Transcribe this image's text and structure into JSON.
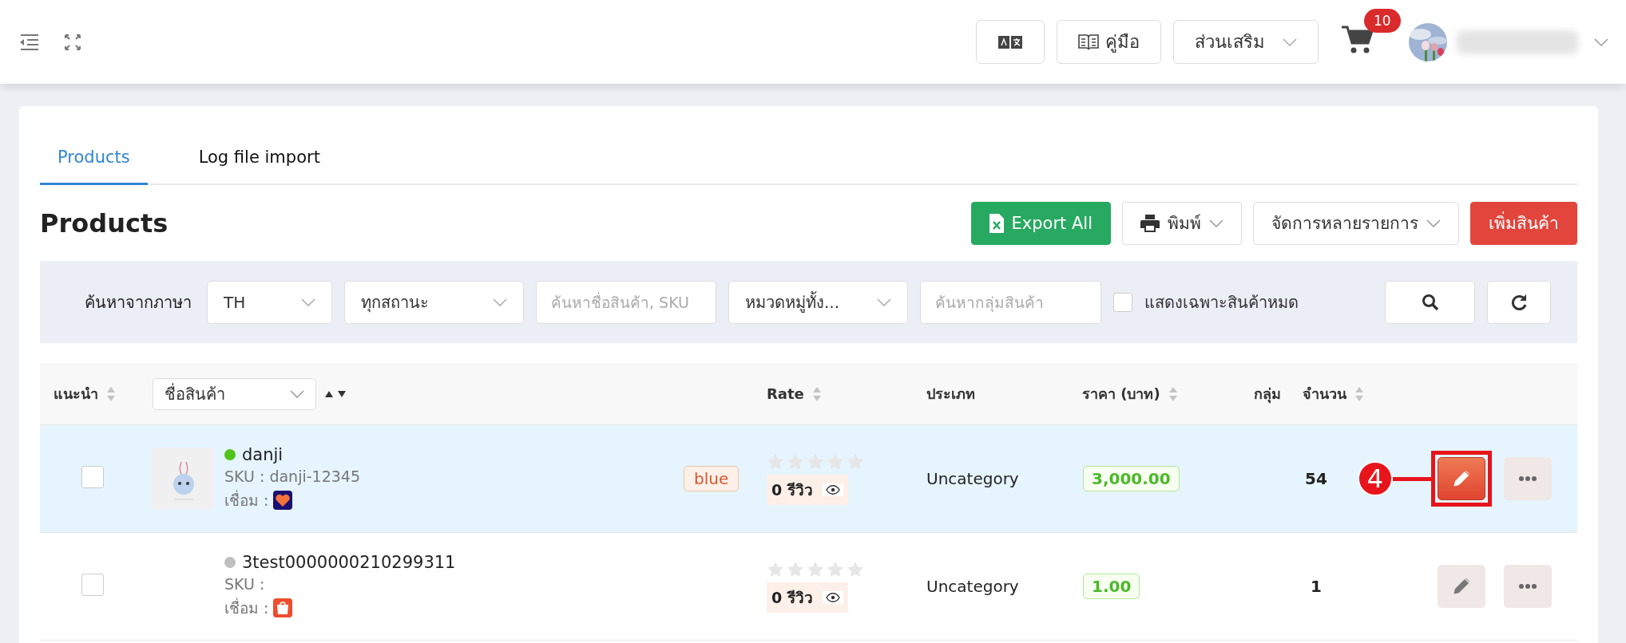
{
  "topbar": {
    "guide_button": "คู่มือ",
    "addons_dropdown": "ส่วนเสริม",
    "cart_count": "10"
  },
  "tabs": [
    {
      "label": "Products",
      "selected": true
    },
    {
      "label": "Log file import",
      "selected": false
    }
  ],
  "page_title": "Products",
  "actions": [
    {
      "label": "Export All",
      "kind": "export"
    },
    {
      "label": "พิมพ์",
      "kind": "print"
    },
    {
      "label": "จัดการหลายรายการ",
      "kind": "dropdown"
    },
    {
      "label": "เพิ่มสินค้า",
      "kind": "add"
    }
  ],
  "filters": {
    "label": "ค้นหาจากภาษา",
    "language": "TH",
    "status": "ทุกสถานะ",
    "search_placeholder": "ค้นหาชื่อสินค้า, SKU",
    "category": "หมวดหมู่ทั้ง...",
    "group_placeholder": "ค้นหากลุ่มสินค้า",
    "out_of_stock_label": "แสดงเฉพาะสินค้าหมด",
    "out_of_stock_checked": false
  },
  "table": {
    "columns": [
      {
        "label": "แนะนำ",
        "sortable": true
      },
      {
        "label": "ชื่อสินค้า",
        "kind": "select"
      },
      {
        "label": "Rate",
        "sortable": true
      },
      {
        "label": "ประเภท",
        "sortable": false
      },
      {
        "label": "ราคา (บาท)",
        "sortable": true
      },
      {
        "label": "กลุ่ม",
        "sortable": false
      },
      {
        "label": "จำนวน",
        "sortable": true
      }
    ],
    "rows": [
      {
        "highlighted": true,
        "checked": false,
        "has_image": true,
        "color": "#52c41a",
        "name": "danji",
        "sku": "SKU : danji-12345",
        "linked_label": "เชื่อม :",
        "channel": {
          "kind": "lazada"
        },
        "tag": "blue",
        "stars": 0,
        "reviews": "0 รีวิว",
        "type": "Uncategory",
        "price": "3,000.00",
        "quantity": "54",
        "callout": "4"
      },
      {
        "highlighted": false,
        "checked": false,
        "has_image": false,
        "color": "#bfbfbf",
        "name": "3test0000000210299311",
        "sku": "SKU :",
        "linked_label": "เชื่อม :",
        "channel": {
          "kind": "shopee"
        },
        "stars": 0,
        "reviews": "0 รีวิว",
        "type": "Uncategory",
        "price": "1.00",
        "quantity": "1"
      }
    ]
  }
}
